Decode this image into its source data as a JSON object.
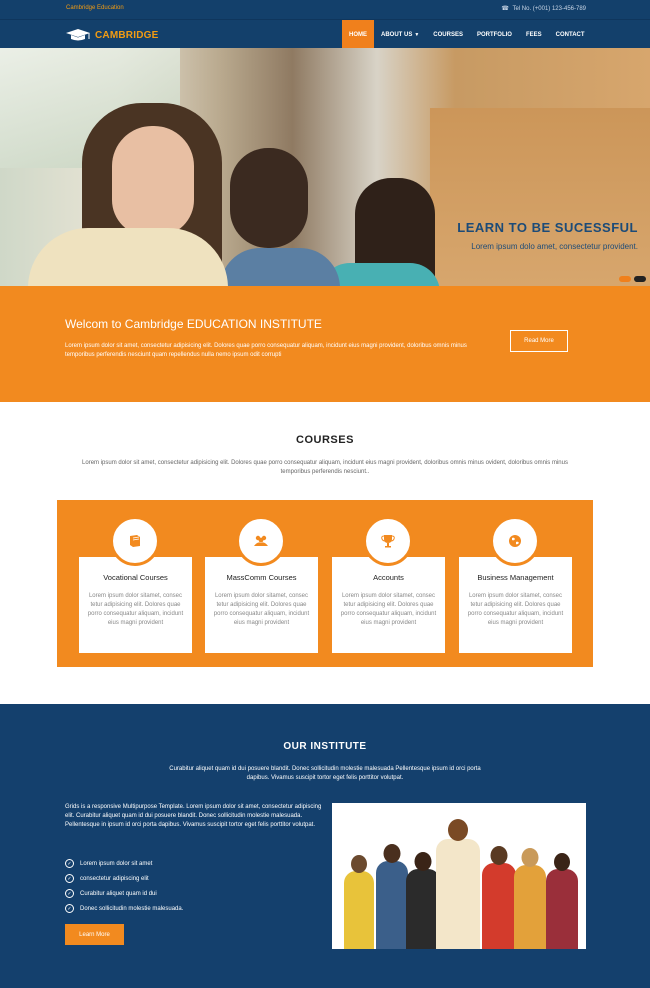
{
  "topbar": {
    "brand": "Cambridge Education",
    "phone_icon": "phone-icon",
    "phone": "Tel No. (+001) 123-456-789"
  },
  "nav": {
    "logo_icon": "graduation-cap-icon",
    "logo_text": "CAMBRIDGE",
    "items": [
      {
        "label": "HOME",
        "active": true
      },
      {
        "label": "ABOUT US",
        "dropdown": true
      },
      {
        "label": "COURSES"
      },
      {
        "label": "PORTFOLIO"
      },
      {
        "label": "FEES"
      },
      {
        "label": "CONTACT"
      }
    ]
  },
  "hero": {
    "title": "LEARN TO BE SUCESSFUL",
    "subtitle": "Lorem ipsum dolo amet, consectetur provident."
  },
  "welcome": {
    "title": "Welcom to Cambridge EDUCATION INSTITUTE",
    "text": "Lorem ipsum dolor sit amet, consectetur adipisicing elit. Dolores quae porro consequatur aliquam, incidunt eius magni provident, doloribus omnis minus temporibus perferendis nesciunt quam repellendus nulla nemo ipsum odit corrupti",
    "button": "Read More"
  },
  "courses": {
    "title": "COURSES",
    "description": "Lorem ipsum dolor sit amet, consectetur adipisicing elit. Dolores quae porro consequatur aliquam, incidunt eius magni provident, doloribus omnis minus ovident, doloribus omnis minus temporibus perferendis nesciunt..",
    "cards": [
      {
        "icon": "book-icon",
        "title": "Vocational Courses",
        "text": "Lorem ipsum dolor sitamet, consec tetur adipisicing elit. Dolores quae porro consequatur aliquam, incidunt eius magni provident"
      },
      {
        "icon": "users-icon",
        "title": "MassComm Courses",
        "text": "Lorem ipsum dolor sitamet, consec tetur adipisicing elit. Dolores quae porro consequatur aliquam, incidunt eius magni provident"
      },
      {
        "icon": "trophy-icon",
        "title": "Accounts",
        "text": "Lorem ipsum dolor sitamet, consec tetur adipisicing elit. Dolores quae porro consequatur aliquam, incidunt eius magni provident"
      },
      {
        "icon": "globe-icon",
        "title": "Business Management",
        "text": "Lorem ipsum dolor sitamet, consec tetur adipisicing elit. Dolores quae porro consequatur aliquam, incidunt eius magni provident"
      }
    ]
  },
  "institute": {
    "title": "OUR INSTITUTE",
    "description": "Curabitur aliquet quam id dui posuere blandit. Donec sollicitudin molestie malesuada Pellentesque ipsum id orci porta dapibus. Vivamus suscipit tortor eget felis porttitor volutpat.",
    "paragraph": "Grids is a responsive Multipurpose Template. Lorem ipsum dolor sit amet, consectetur adipiscing elit. Curabitur aliquet quam id dui posuere blandit. Donec sollicitudin molestie malesuada. Pellentesque in ipsum id orci porta dapibus. Vivamus suscipit tortor eget felis porttitor volutpat.",
    "list": [
      "Lorem ipsum dolor sit amet",
      "consectetur adipiscing elit",
      "Curabitur aliquet quam id dui",
      "Donec sollicitudin molestie malesuada."
    ],
    "button": "Learn More"
  },
  "colors": {
    "navy": "#13406b",
    "orange": "#f28a1f",
    "white": "#ffffff"
  }
}
